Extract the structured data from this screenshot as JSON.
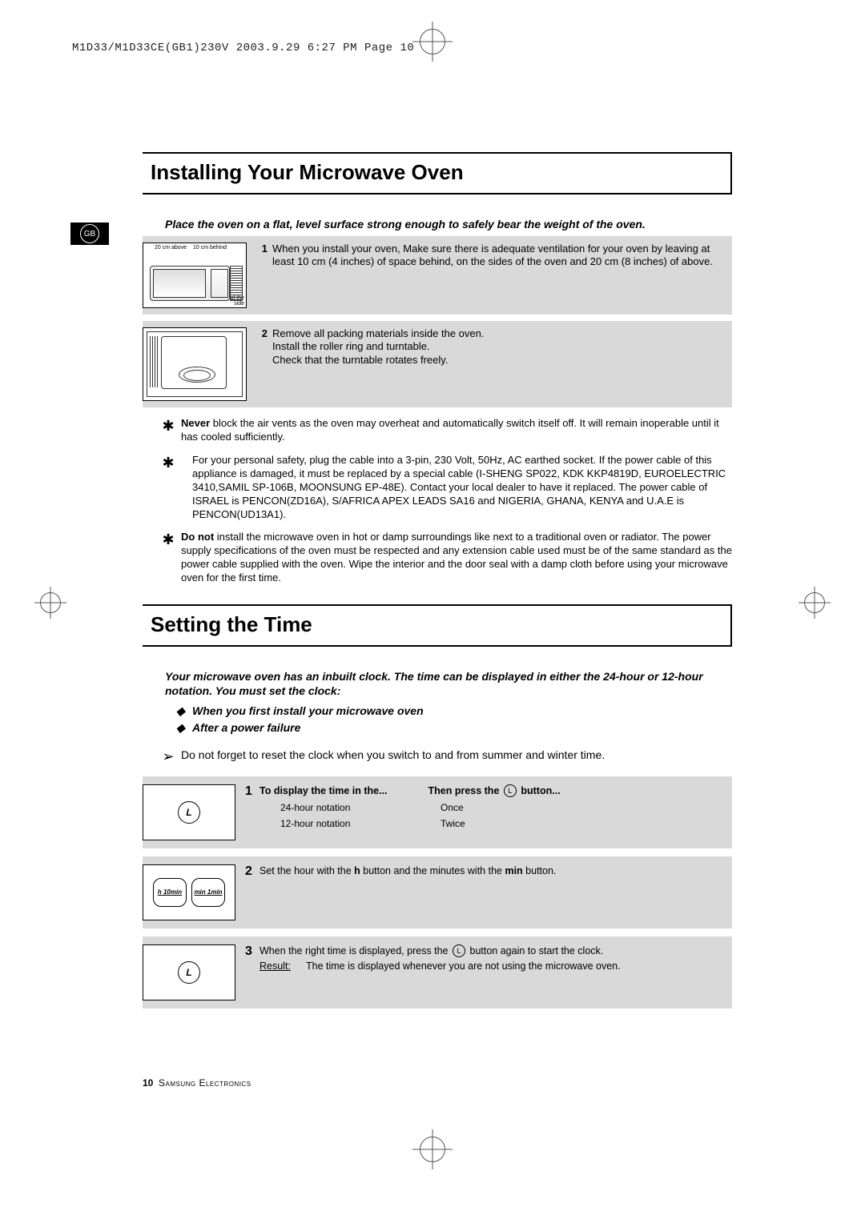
{
  "print_header": "M1D33/M1D33CE(GB1)230V  2003.9.29  6:27 PM  Page 10",
  "lang_tab": "GB",
  "section1": {
    "title": "Installing Your Microwave Oven",
    "intro": "Place the oven on a flat, level surface strong enough to safely bear the weight of the oven.",
    "clearance": {
      "above": "20 cm above",
      "behind": "10 cm behind",
      "side": "10 cm of the side"
    },
    "step1": "When you install your oven, Make sure there is adequate ventilation for your oven by leaving at least 10 cm (4 inches) of space behind, on the sides of the oven and 20 cm (8 inches) of above.",
    "step2a": "Remove all packing materials inside the oven.",
    "step2b": "Install the roller ring and turntable.",
    "step2c": "Check that the turntable rotates freely.",
    "note1_lead": "Never",
    "note1": " block the air vents as the oven may overheat and automatically switch itself off. It will remain inoperable until it has cooled sufficiently.",
    "note2": "For your personal safety, plug the cable into a 3-pin, 230 Volt, 50Hz, AC earthed socket. If the power cable of this appliance is damaged, it must be replaced by a special cable (I-SHENG SP022, KDK KKP4819D, EUROELECTRIC 3410,SAMIL SP-106B, MOONSUNG EP-48E). Contact your local dealer to have it replaced. The power cable of ISRAEL is PENCON(ZD16A), S/AFRICA APEX LEADS SA16 and NIGERIA, GHANA, KENYA and U.A.E is PENCON(UD13A1).",
    "note3_lead": "Do not",
    "note3": " install the microwave oven in hot or damp surroundings like next to a traditional oven or radiator. The power supply specifications of the oven must be respected and any extension cable used must be of the same standard as the power cable supplied with the oven. Wipe the interior and the door seal with a damp cloth before using your microwave oven for the first time."
  },
  "section2": {
    "title": "Setting the Time",
    "intro": "Your microwave oven has an inbuilt clock. The time can be displayed in either the 24-hour or 12-hour notation. You must set the clock:",
    "bullet1": "When you first install your microwave oven",
    "bullet2": "After a power failure",
    "arrow_note": "Do not forget to reset the clock when you switch to and from summer and winter time.",
    "buttons": {
      "h10": "h 10min",
      "min1": "min 1min"
    },
    "step1": {
      "head_left": "To display the time in the...",
      "head_right_a": "Then press the ",
      "head_right_b": " button...",
      "r1c1": "24-hour notation",
      "r1c2": "Once",
      "r2c1": "12-hour notation",
      "r2c2": "Twice"
    },
    "step2_a": "Set the hour with the ",
    "step2_b": " button and the minutes with the ",
    "step2_c": " button.",
    "step2_h": "h",
    "step2_min": "min",
    "step3_a": "When the right time is displayed, press the ",
    "step3_b": " button again to start the clock.",
    "step3_res_label": "Result",
    "step3_res": "The time is displayed whenever you are not using the microwave oven."
  },
  "footer": {
    "page": "10",
    "brand": "Samsung Electronics"
  },
  "icons": {
    "clock_letter": "L"
  }
}
